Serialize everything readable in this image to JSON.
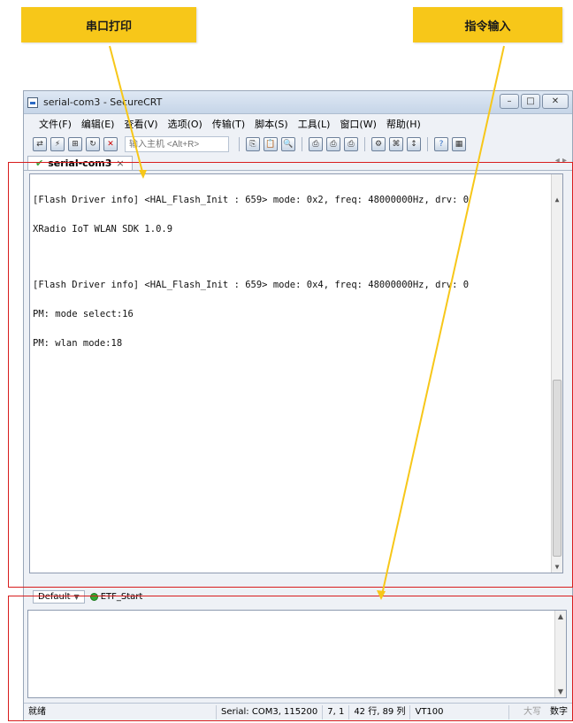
{
  "callouts": {
    "serial_print": "串口打印",
    "command_input": "指令输入"
  },
  "window": {
    "title": "serial-com3 - SecureCRT",
    "buttons": {
      "minimize": "–",
      "maximize": "□",
      "close": "✕"
    }
  },
  "menu": [
    "文件(F)",
    "编辑(E)",
    "查看(V)",
    "选项(O)",
    "传输(T)",
    "脚本(S)",
    "工具(L)",
    "窗口(W)",
    "帮助(H)"
  ],
  "toolbar": {
    "quick_connect_placeholder": "输入主机 <Alt+R>",
    "icons": [
      "connect-icon",
      "quick-connect-icon",
      "connect-tab-icon",
      "reconnect-icon",
      "disconnect-icon",
      "copy-icon",
      "paste-icon",
      "find-icon",
      "print-icon",
      "print-setup-icon",
      "print-screen-icon",
      "session-options-icon",
      "keymap-icon",
      "sftp-icon",
      "help-icon",
      "monitor-icon"
    ]
  },
  "tab": {
    "label": "serial-com3",
    "close": "×",
    "nav": "◂ ▸"
  },
  "terminal": {
    "lines": [
      "[Flash Driver info] <HAL_Flash_Init : 659> mode: 0x2, freq: 48000000Hz, drv: 0",
      "XRadio IoT WLAN SDK 1.0.9",
      "",
      "[Flash Driver info] <HAL_Flash_Init : 659> mode: 0x4, freq: 48000000Hz, drv: 0",
      "PM: mode select:16",
      "PM: wlan mode:18"
    ]
  },
  "button_bar": {
    "default_label": "Default",
    "button_label": "ETF_Start"
  },
  "statusbar": {
    "ready": "就绪",
    "connection": "Serial: COM3, 115200",
    "cursor": "7,   1",
    "size": "42 行, 89 列",
    "emulation": "VT100",
    "caps": "大写",
    "num": "数字"
  },
  "colors": {
    "callout": "#f7c719",
    "highlight": "#d81d1d"
  }
}
